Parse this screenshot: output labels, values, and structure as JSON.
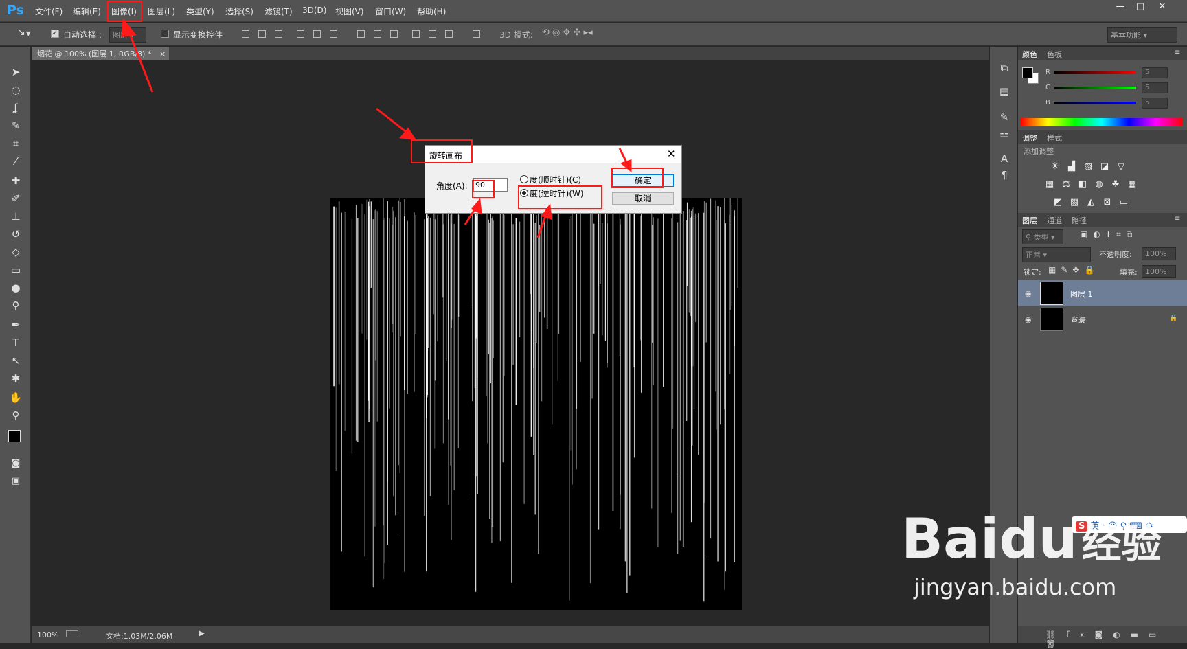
{
  "app": {
    "logo": "Ps",
    "menu": [
      "文件(F)",
      "编辑(E)",
      "图像(I)",
      "图层(L)",
      "类型(Y)",
      "选择(S)",
      "滤镜(T)",
      "3D(D)",
      "视图(V)",
      "窗口(W)",
      "帮助(H)"
    ],
    "window_controls": [
      "—",
      "□",
      "✕"
    ]
  },
  "options_bar": {
    "auto_select_label": "自动选择 :",
    "auto_select_checked": true,
    "auto_select_target": "图层",
    "show_transform_label": "显示变换控件",
    "show_transform_checked": false,
    "mode_3d_label": "3D 模式:",
    "workspace": "基本功能"
  },
  "document": {
    "tab_title": "烟花 @ 100% (图层 1, RGB/8) *"
  },
  "status": {
    "zoom": "100%",
    "doc_size": "文档:1.03M/2.06M"
  },
  "dialog": {
    "title": "旋转画布",
    "angle_label": "角度(A):",
    "angle_value": "90",
    "option_cw": "度(顺时针)(C)",
    "option_ccw": "度(逆时针)(W)",
    "ccw_selected": true,
    "ok_label": "确定",
    "cancel_label": "取消"
  },
  "color_panel": {
    "tabs": [
      "颜色",
      "色板"
    ],
    "channels": [
      {
        "label": "R",
        "value": "5",
        "color": "#ff0000"
      },
      {
        "label": "G",
        "value": "5",
        "color": "#00ff00"
      },
      {
        "label": "B",
        "value": "5",
        "color": "#0000ff"
      }
    ]
  },
  "adjust_panel": {
    "tabs": [
      "调整",
      "样式"
    ],
    "subtitle": "添加调整"
  },
  "layers_panel": {
    "tabs": [
      "图层",
      "通道",
      "路径"
    ],
    "filter_label": "类型",
    "blend_mode": "正常",
    "opacity_label": "不透明度:",
    "opacity_value": "100%",
    "lock_label": "锁定:",
    "fill_label": "填充:",
    "fill_value": "100%",
    "layers": [
      {
        "name": "图层 1",
        "selected": true
      },
      {
        "name": "背景",
        "selected": false
      }
    ]
  },
  "watermark": {
    "brand": "Bai",
    "brand_du": "du",
    "cn": "经验",
    "url": "jingyan.baidu.com"
  },
  "ime": {
    "logo": "S",
    "text": "英"
  },
  "colors": {
    "chrome": "#535353",
    "workspace": "#282828",
    "annotation_red": "#ff1a1a",
    "selected_layer": "#6d7e96"
  }
}
